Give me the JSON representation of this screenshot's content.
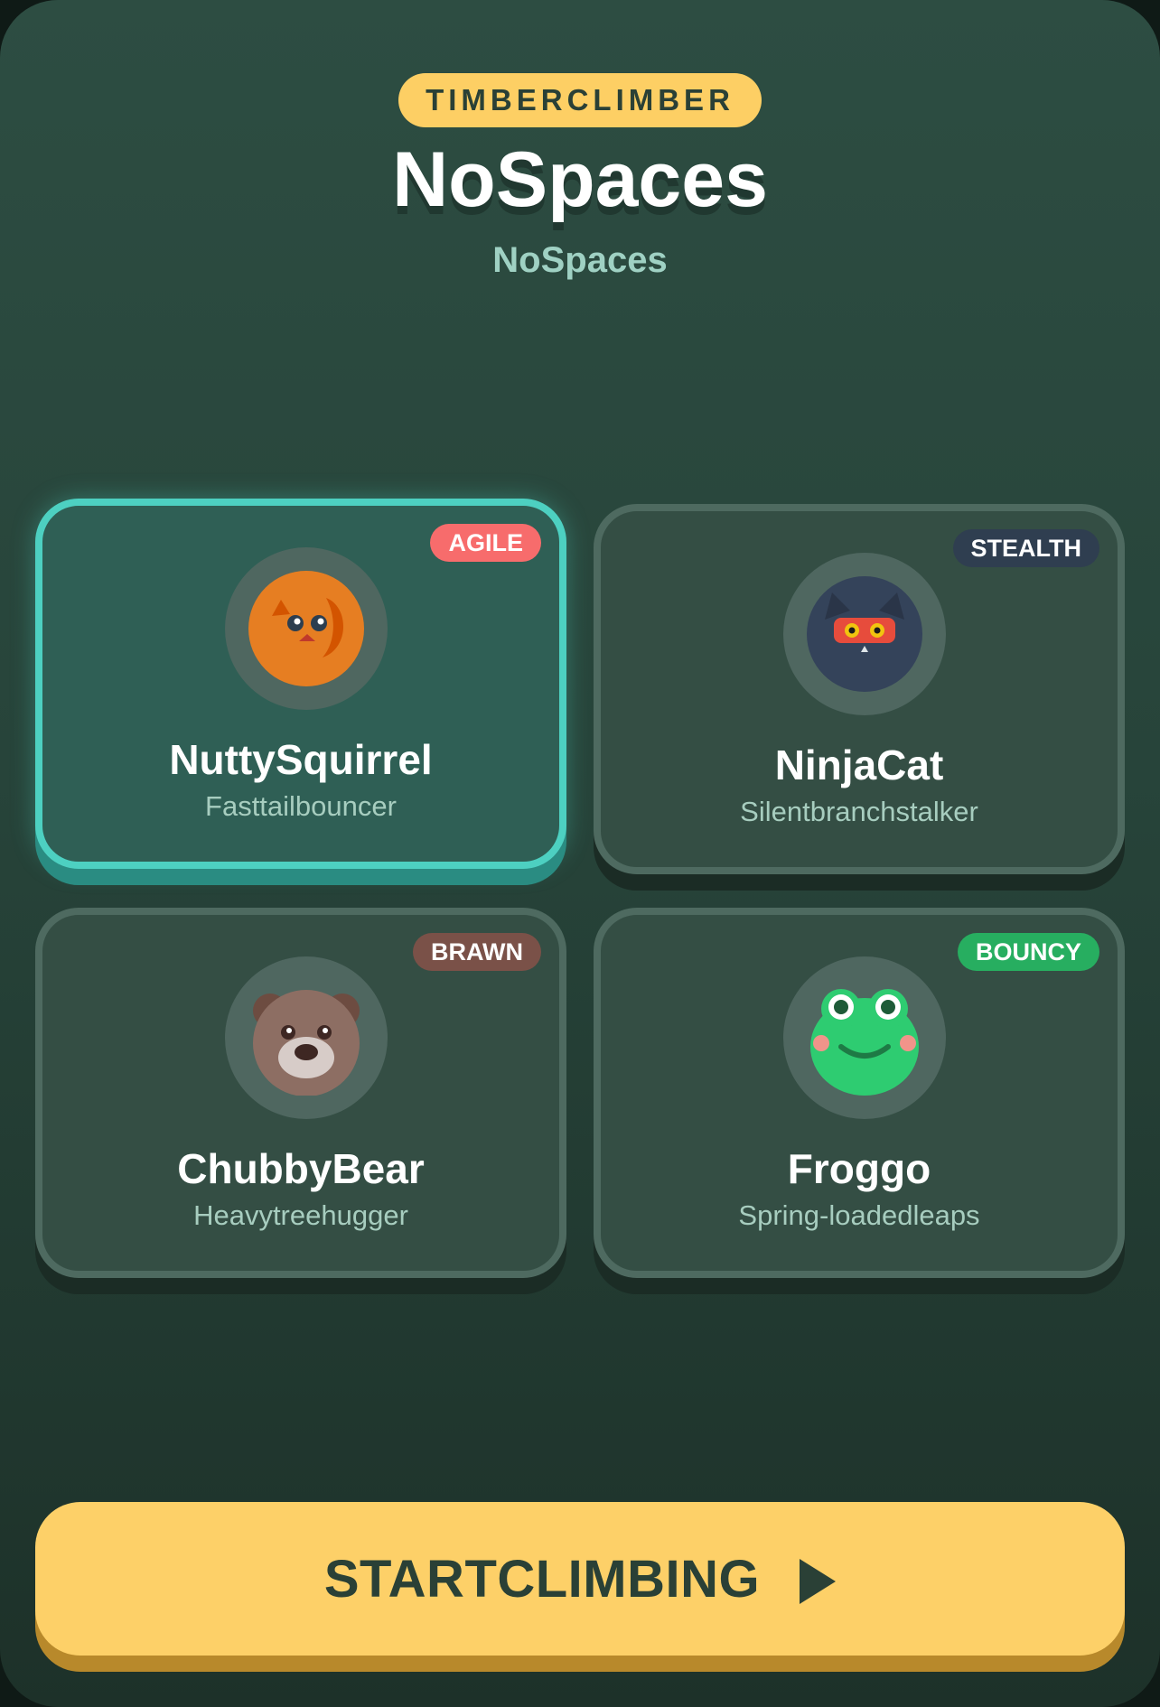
{
  "header": {
    "tag": "TIMBERCLIMBER",
    "title": "NoSpaces",
    "subtitle": "NoSpaces"
  },
  "characters": [
    {
      "name": "NuttySquirrel",
      "description": "Fasttailbouncer",
      "badge": "AGILE",
      "badge_color": "#f76c6c",
      "icon": "squirrel-icon",
      "selected": true
    },
    {
      "name": "NinjaCat",
      "description": "Silentbranchstalker",
      "badge": "STEALTH",
      "badge_color": "#2f3e50",
      "icon": "cat-icon",
      "selected": false
    },
    {
      "name": "ChubbyBear",
      "description": "Heavytreehugger",
      "badge": "BRAWN",
      "badge_color": "#7a5148",
      "icon": "bear-icon",
      "selected": false
    },
    {
      "name": "Froggo",
      "description": "Spring-loadedleaps",
      "badge": "BOUNCY",
      "badge_color": "#27ae60",
      "icon": "frog-icon",
      "selected": false
    }
  ],
  "cta": {
    "label": "STARTCLIMBING",
    "icon": "play-icon"
  },
  "colors": {
    "accent": "#fdcf64",
    "selected_border": "#4dd0c1"
  }
}
